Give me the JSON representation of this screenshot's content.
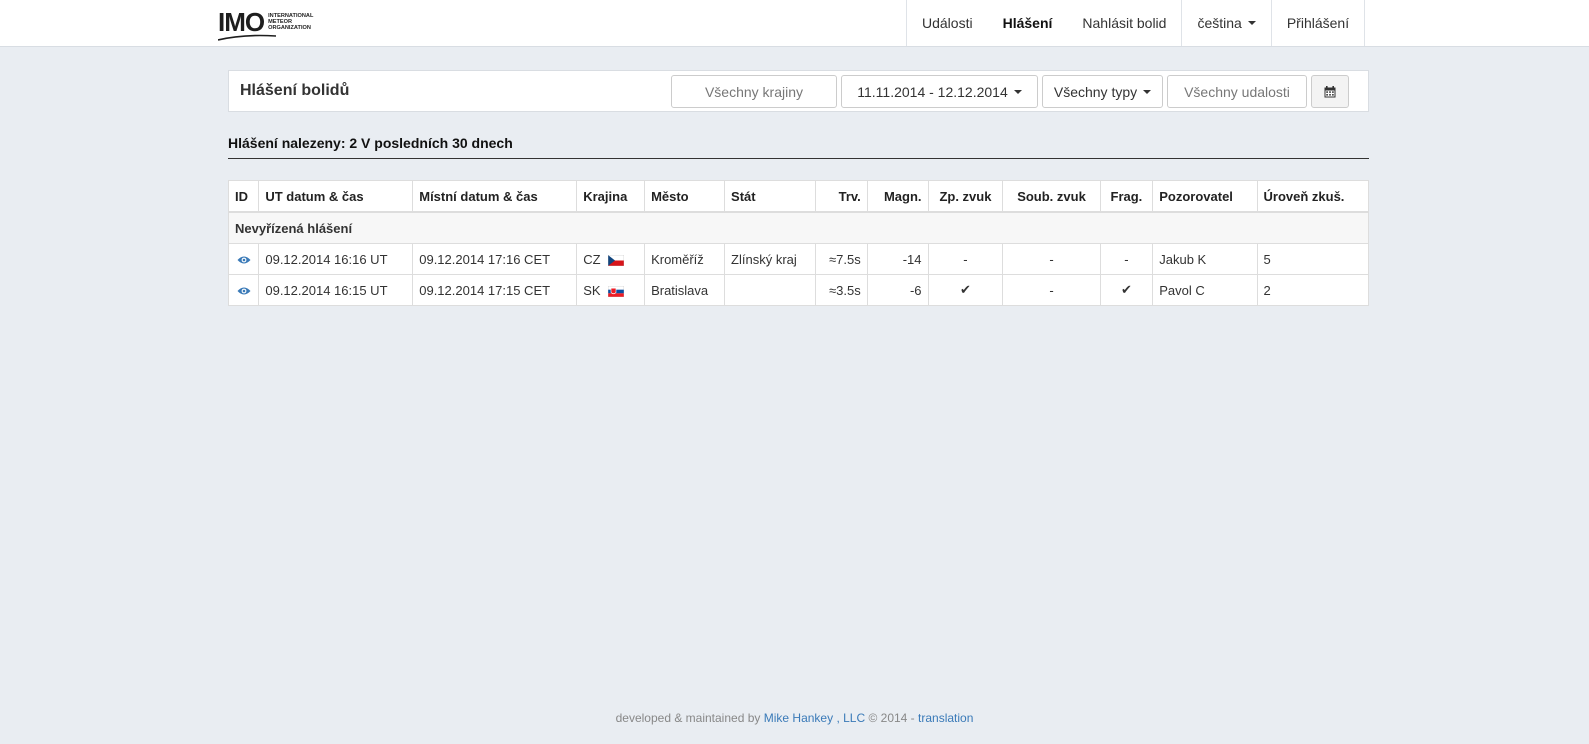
{
  "logo": {
    "main": "IMO",
    "sub_line1": "INTERNATIONAL",
    "sub_line2": "METEOR",
    "sub_line3": "ORGANIZATION"
  },
  "nav": {
    "events": "Události",
    "reports": "Hlášení",
    "report_fireball": "Nahlásit bolid",
    "language": "čeština",
    "login": "Přihlášení"
  },
  "panel": {
    "title": "Hlášení bolidů",
    "country_placeholder": "Všechny krajiny",
    "date_range": "11.11.2014 - 12.12.2014",
    "types": "Všechny typy",
    "events_placeholder": "Všechny udalosti",
    "calendar_icon": "calendar-icon"
  },
  "results": {
    "heading": "Hlášení nalezeny: 2 V posledních 30 dnech"
  },
  "table": {
    "headers": [
      "ID",
      "UT datum & čas",
      "Místní datum & čas",
      "Krajina",
      "Město",
      "Stát",
      "Trv.",
      "Magn.",
      "Zp. zvuk",
      "Soub. zvuk",
      "Frag.",
      "Pozorovatel",
      "Úroveň zkuš."
    ],
    "group_label": "Nevyřízená hlášení",
    "rows": [
      {
        "ut": "09.12.2014 16:16 UT",
        "local": "09.12.2014 17:16 CET",
        "country": "CZ",
        "city": "Kroměříž",
        "state": "Zlínský kraj",
        "duration": "≈7.5s",
        "magnitude": "-14",
        "delayed_sound": "-",
        "simultaneous_sound": "-",
        "fragmentation": "-",
        "observer": "Jakub K",
        "experience": "5"
      },
      {
        "ut": "09.12.2014 16:15 UT",
        "local": "09.12.2014 17:15 CET",
        "country": "SK",
        "city": "Bratislava",
        "state": "",
        "duration": "≈3.5s",
        "magnitude": "-6",
        "delayed_sound": "✔",
        "simultaneous_sound": "-",
        "fragmentation": "✔",
        "observer": "Pavol C",
        "experience": "2"
      }
    ]
  },
  "footer": {
    "prefix": "developed & maintained by",
    "author": "Mike Hankey",
    "company": ", LLC",
    "copyright": "© 2014 -",
    "translation": "translation"
  },
  "colors": {
    "accent": "#3a7ab8",
    "background": "#e9edf2",
    "flag_cz_red": "#d7141a",
    "flag_cz_blue": "#11457e",
    "flag_sk_blue": "#0b4ea2",
    "flag_sk_red": "#ee1c25"
  },
  "icons": {
    "view": "eye-icon",
    "check": "check-icon"
  }
}
